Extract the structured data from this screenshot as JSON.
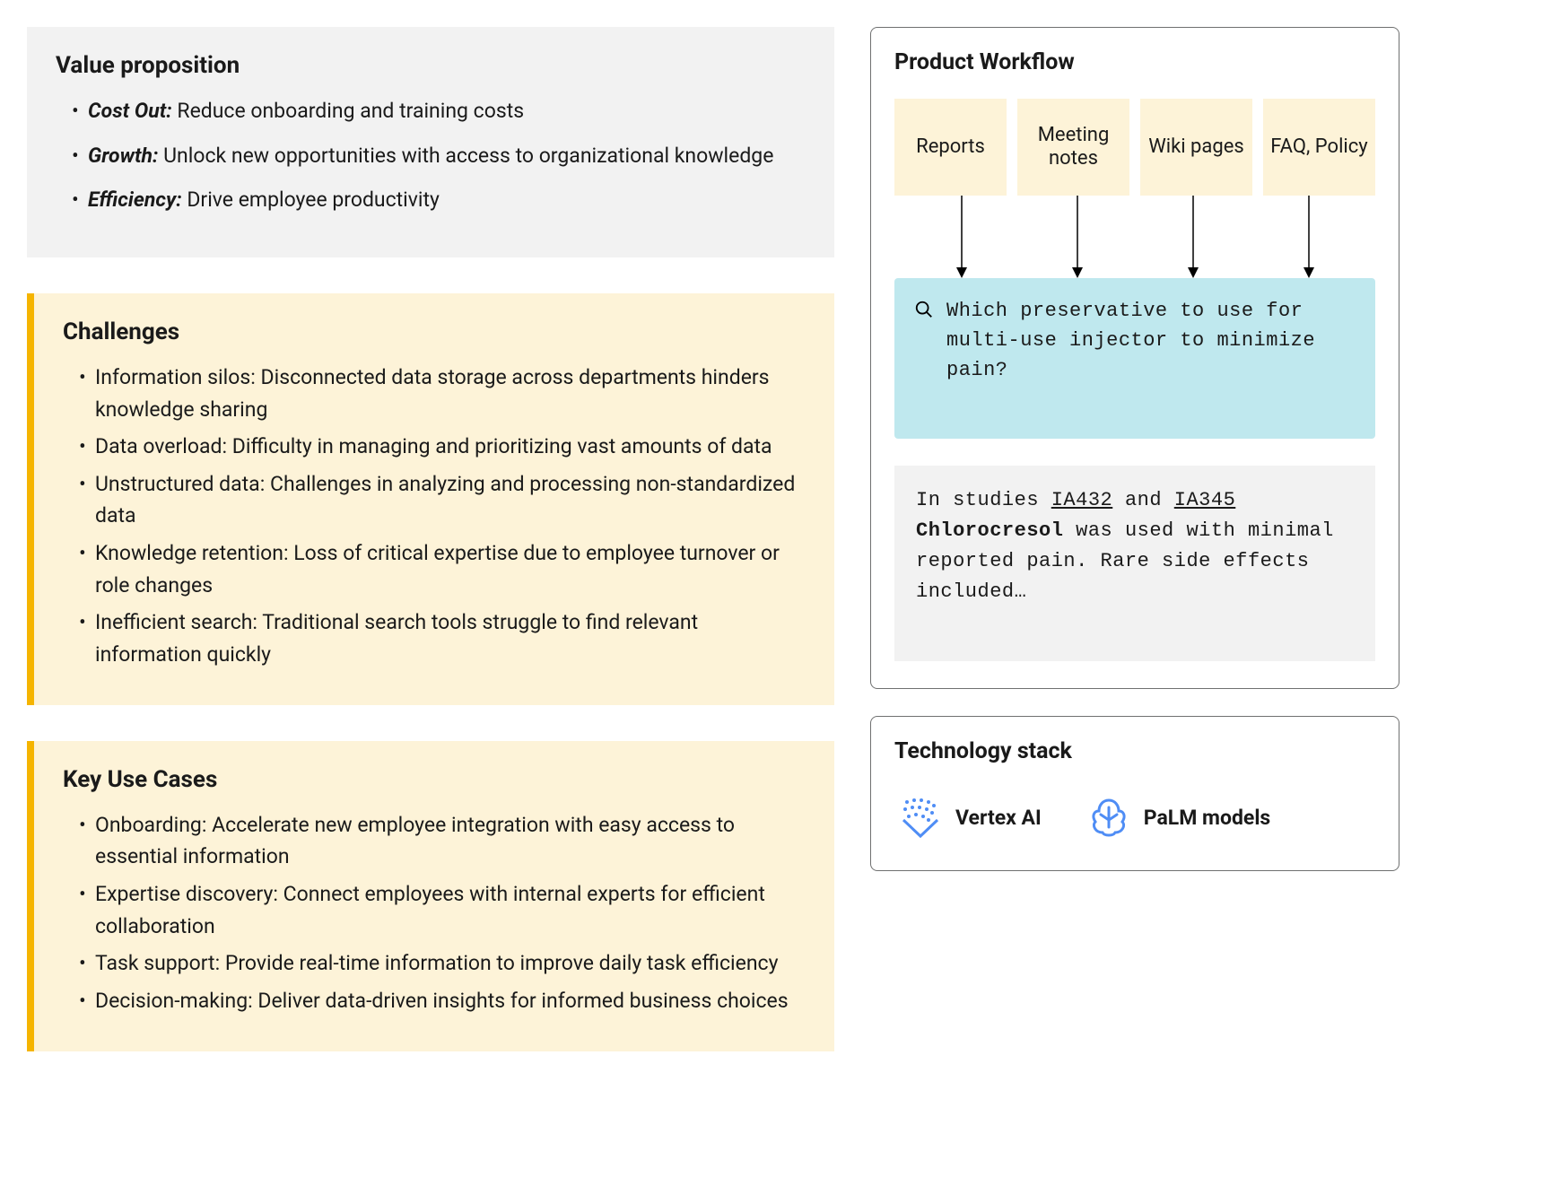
{
  "value_prop": {
    "title": "Value proposition",
    "items": [
      {
        "label": "Cost Out:",
        "text": " Reduce onboarding and training costs"
      },
      {
        "label": "Growth:",
        "text": " Unlock new opportunities with access to organizational knowledge"
      },
      {
        "label": "Efficiency:",
        "text": " Drive employee productivity"
      }
    ]
  },
  "challenges": {
    "title": "Challenges",
    "items": [
      "Information silos: Disconnected data storage across departments hinders knowledge sharing",
      "Data overload: Difficulty in managing and prioritizing vast amounts of data",
      "Unstructured data: Challenges in analyzing and processing non-standardized data",
      "Knowledge retention: Loss of critical expertise due to employee turnover or role changes",
      "Inefficient search: Traditional search tools struggle to find relevant information quickly"
    ]
  },
  "use_cases": {
    "title": "Key Use Cases",
    "items": [
      "Onboarding: Accelerate new employee integration with easy access to essential information",
      "Expertise discovery: Connect employees with internal experts for efficient collaboration",
      "Task support: Provide real-time information to improve daily task efficiency",
      "Decision-making: Deliver data-driven insights for informed business choices"
    ]
  },
  "workflow": {
    "title": "Product Workflow",
    "sources": [
      "Reports",
      "Meeting notes",
      "Wiki pages",
      "FAQ, Policy"
    ],
    "query": "Which preservative to use for multi-use injector to minimize pain?",
    "answer": {
      "pre1": "In studies ",
      "link1": "IA432",
      "mid1": " and ",
      "link2": "IA345",
      "pre2": " ",
      "bold": "Chlorocresol",
      "post": " was used with minimal reported pain. Rare side effects included…"
    }
  },
  "tech": {
    "title": "Technology stack",
    "items": [
      {
        "name": "Vertex AI"
      },
      {
        "name": "PaLM models"
      }
    ]
  }
}
